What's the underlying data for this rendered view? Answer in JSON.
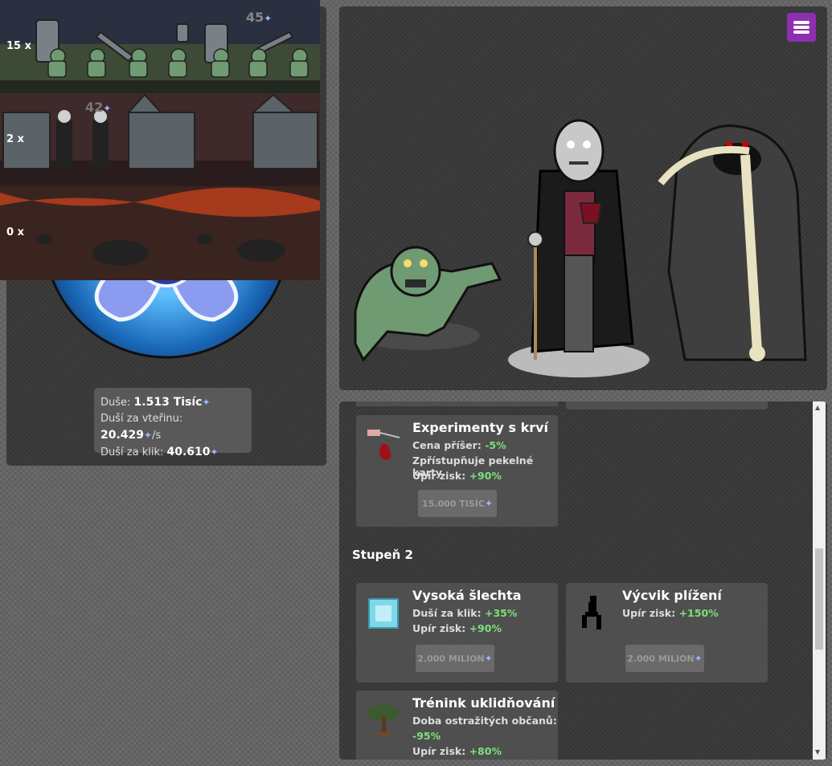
{
  "stats": {
    "souls_label": "Duše:",
    "souls_value": "1.513 Tisíc",
    "per_second_label": "Duší za vteřinu:",
    "per_second_value": "20.429",
    "per_second_unit": "/s",
    "per_click_label": "Duší za klik:",
    "per_click_value": "40.610"
  },
  "army": {
    "rows": [
      {
        "count": "15 x",
        "cost": "45"
      },
      {
        "count": "2 x",
        "cost": "42"
      },
      {
        "count": "0 x"
      }
    ]
  },
  "shop": {
    "cards": [
      {
        "title": "Experimenty s krví",
        "lines": [
          {
            "label": "Cena příšer:",
            "value": "-5%"
          },
          {
            "label": "Zpřístupňuje pekelné karty",
            "value": ""
          },
          {
            "label": "Upír zisk:",
            "value": "+90%"
          }
        ],
        "price": "15.000 TISÍC"
      },
      {
        "title": "Vysoká šlechta",
        "lines": [
          {
            "label": "Duší za klik:",
            "value": "+35%"
          },
          {
            "label": "Upír zisk:",
            "value": "+90%"
          }
        ],
        "price": "2.000 MILION"
      },
      {
        "title": "Výcvik plížení",
        "lines": [
          {
            "label": "Upír zisk:",
            "value": "+150%"
          }
        ],
        "price": "2.000 MILION"
      },
      {
        "title": "Trénink uklidňování",
        "lines": [
          {
            "label": "Doba ostražitých občanů:",
            "value": ""
          },
          {
            "label": "",
            "value": "-95%"
          },
          {
            "label": "Upír zisk:",
            "value": "+80%"
          }
        ]
      }
    ],
    "section_title": "Stupeň 2"
  },
  "icons": {
    "soul": "butterfly-icon",
    "menu": "hamburger-menu-icon"
  },
  "colors": {
    "menu_button": "#8e2fb0",
    "positive": "#7de07d",
    "soul_icon": "#9ab6ff"
  }
}
